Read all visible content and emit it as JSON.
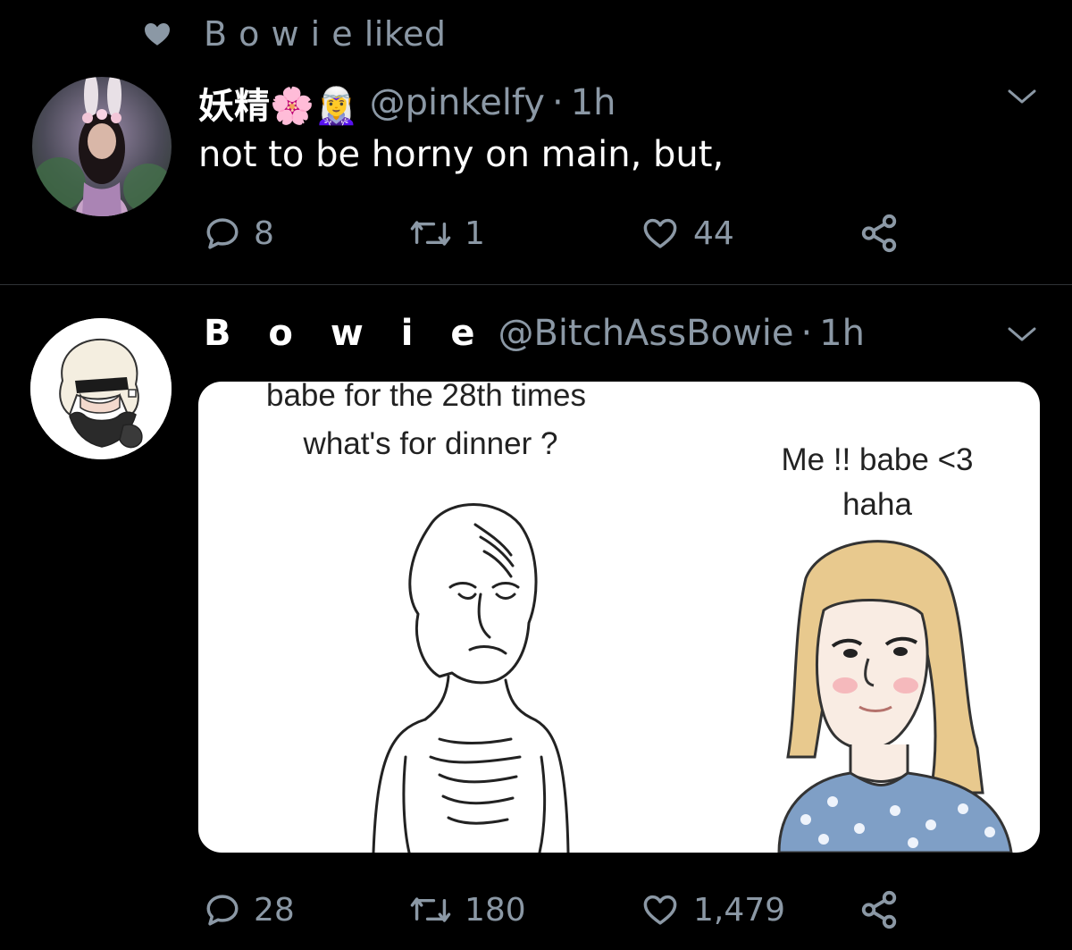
{
  "social_context": {
    "icon": "heart-icon",
    "text": "B o w i  e liked"
  },
  "tweet1": {
    "display_name": "妖精🌸🧝‍♀️",
    "handle": "@pinkelfy",
    "separator": "·",
    "time": "1h",
    "text": "not to be horny on main, but,",
    "actions": {
      "replies": "8",
      "retweets": "1",
      "likes": "44"
    }
  },
  "tweet2": {
    "display_name": "B o w i  e",
    "handle": "@BitchAssBowie",
    "separator": "·",
    "time": "1h",
    "media": {
      "left_caption_line1": "babe for the 28th times",
      "left_caption_line2": "what's for dinner ?",
      "right_caption_line1": "Me !! babe <3",
      "right_caption_line2": "haha"
    },
    "actions": {
      "replies": "28",
      "retweets": "180",
      "likes": "1,479"
    }
  },
  "colors": {
    "background": "#000000",
    "muted": "#8b98a5",
    "divider": "#2f3336"
  }
}
